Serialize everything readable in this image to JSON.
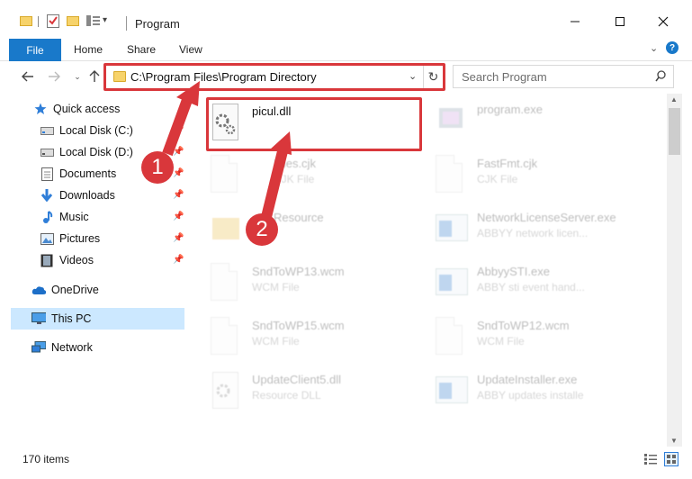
{
  "window": {
    "title": "Program",
    "controls": [
      "minimize-icon",
      "maximize-icon",
      "close-icon"
    ]
  },
  "ribbon": {
    "tabs": [
      {
        "label": "File",
        "active": true
      },
      {
        "label": "Home"
      },
      {
        "label": "Share"
      },
      {
        "label": "View"
      }
    ]
  },
  "address": {
    "path": "C:\\Program Files\\Program Directory"
  },
  "search": {
    "placeholder": "Search Program"
  },
  "sidebar": {
    "items": [
      {
        "label": "Quick access",
        "icon": "star-icon"
      },
      {
        "label": "Local Disk (C:)",
        "icon": "drive-icon",
        "pinned": true
      },
      {
        "label": "Local Disk (D:)",
        "icon": "drive-icon",
        "pinned": true
      },
      {
        "label": "Documents",
        "icon": "documents-icon",
        "pinned": true
      },
      {
        "label": "Downloads",
        "icon": "download-icon",
        "pinned": true
      },
      {
        "label": "Music",
        "icon": "music-icon",
        "pinned": true
      },
      {
        "label": "Pictures",
        "icon": "pictures-icon",
        "pinned": true
      },
      {
        "label": "Videos",
        "icon": "videos-icon",
        "pinned": true
      },
      {
        "label": "OneDrive",
        "icon": "cloud-icon"
      },
      {
        "label": "This PC",
        "icon": "pc-icon",
        "selected": true
      },
      {
        "label": "Network",
        "icon": "network-icon"
      }
    ]
  },
  "files": [
    {
      "name": "picul.dll",
      "type": "",
      "icon": "dll-gear-icon",
      "highlighted": true
    },
    {
      "name": "program.exe",
      "type": "",
      "icon": "exe-icon"
    },
    {
      "name": "Files.cjk",
      "type": "CJK File",
      "icon": "document-icon"
    },
    {
      "name": "FastFmt.cjk",
      "type": "CJK File",
      "icon": "document-icon"
    },
    {
      "name": "Resource",
      "type": "",
      "icon": "folder-icon"
    },
    {
      "name": "NetworkLicenseServer.exe",
      "type": "ABBYY network licen...",
      "icon": "window-app-icon"
    },
    {
      "name": "SndToWP13.wcm",
      "type": "WCM File",
      "icon": "document-icon"
    },
    {
      "name": "AbbyySTI.exe",
      "type": "ABBY sti event hand...",
      "icon": "window-app-icon"
    },
    {
      "name": "SndToWP15.wcm",
      "type": "WCM File",
      "icon": "document-icon"
    },
    {
      "name": "SndToWP12.wcm",
      "type": "WCM File",
      "icon": "document-icon"
    },
    {
      "name": "UpdateClient5.dll",
      "type": "Resource DLL",
      "icon": "dll-gear-icon"
    },
    {
      "name": "UpdateInstaller.exe",
      "type": "ABBY updates installe",
      "icon": "window-app-icon"
    }
  ],
  "status": {
    "items_count": "170 items"
  },
  "callouts": [
    {
      "number": "1"
    },
    {
      "number": "2"
    }
  ],
  "colors": {
    "accent": "#1979ca",
    "highlight": "#d9373b",
    "selected": "#cce8ff"
  }
}
